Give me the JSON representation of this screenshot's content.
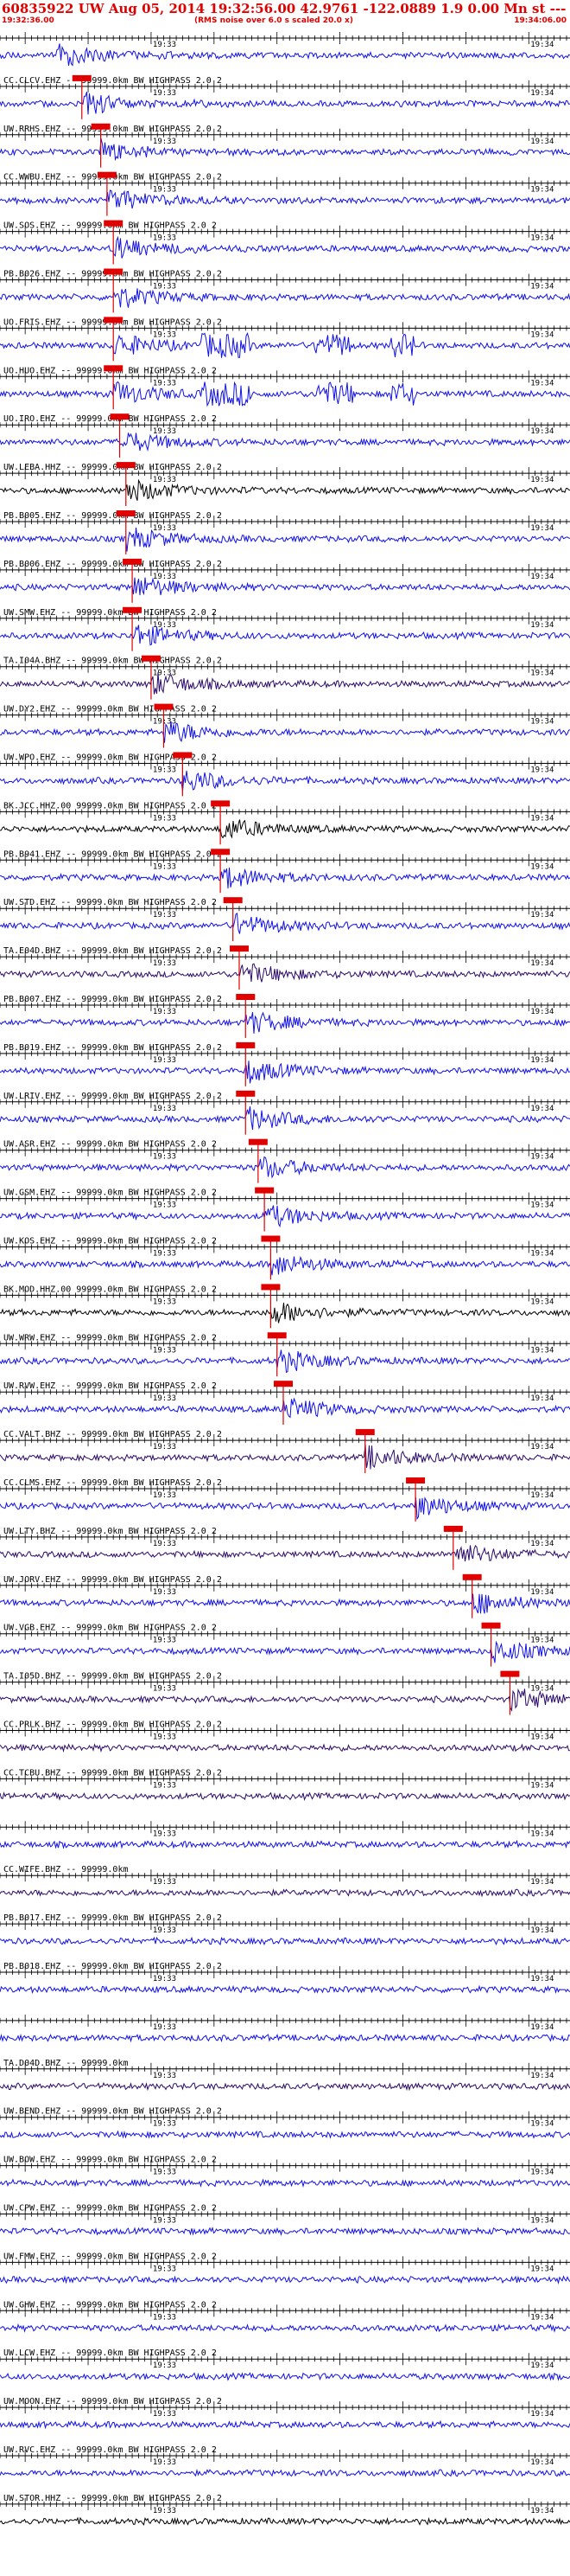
{
  "header": {
    "title": "60835922 UW Aug 05, 2014 19:32:56.00   42.9761 -122.0889  1.9 0.00 Mn st --- -- -- -1",
    "start_time": "19:32:36.00",
    "rms_note": "(RMS noise over 6.0 s scaled 20.0 x)",
    "end_time": "19:34:06.00"
  },
  "tick_labels": {
    "left": "19:33",
    "right": "19:34"
  },
  "colors": {
    "trace_blue": "#1010e8",
    "trace_black": "#000000",
    "trace_purple": "#2a0a6a",
    "pick": "#e00000",
    "axis": "#000000"
  },
  "traces": [
    {
      "label": "",
      "color": "blue",
      "pick": "",
      "pick_sec": 9
    },
    {
      "label": "CC.CLCV.EHZ -- 99999.0km BW  HIGHPASS  2.0  2",
      "color": "blue",
      "pick": "P",
      "pick_sec": 13
    },
    {
      "label": "UW.RRHS.EHZ -- 99999.0km BW  HIGHPASS  2.0  2",
      "color": "blue",
      "pick": "P",
      "pick_sec": 16
    },
    {
      "label": "CC.WWBU.EHZ -- 99999.0km BW  HIGHPASS  2.0  2",
      "color": "blue",
      "pick": "P",
      "pick_sec": 17
    },
    {
      "label": "UW.SOS.EHZ -- 99999.0km BW  HIGHPASS  2.0  2",
      "color": "blue",
      "pick": "P",
      "pick_sec": 18
    },
    {
      "label": "PB.B026.EHZ -- 99999.0km BW  HIGHPASS  2.0  2",
      "color": "blue",
      "pick": "P",
      "pick_sec": 18
    },
    {
      "label": "UO.FRIS.EHZ -- 99999.0km BW  HIGHPASS  2.0  2",
      "color": "blue",
      "pick": "P",
      "pick_sec": 18
    },
    {
      "label": "UO.HUO.EHZ -- 99999.0km BW  HIGHPASS  2.0  2",
      "color": "blue",
      "pick": "P",
      "pick_sec": 18
    },
    {
      "label": "UO.IRO.EHZ -- 99999.0km BW  HIGHPASS  2.0  2",
      "color": "blue",
      "pick": "P",
      "pick_sec": 19
    },
    {
      "label": "UW.LEBA.HHZ -- 99999.0km BW  HIGHPASS  2.0  2",
      "color": "black",
      "pick": "P",
      "pick_sec": 20
    },
    {
      "label": "PB.B005.EHZ -- 99999.0km BW  HIGHPASS  2.0  2",
      "color": "blue",
      "pick": "P",
      "pick_sec": 20
    },
    {
      "label": "PB.B006.EHZ -- 99999.0km BW  HIGHPASS  2.0  2",
      "color": "blue",
      "pick": "P",
      "pick_sec": 21
    },
    {
      "label": "UW.SMW.EHZ -- 99999.0km BW  HIGHPASS  2.0  2",
      "color": "blue",
      "pick": "P",
      "pick_sec": 21
    },
    {
      "label": "TA.I04A.BHZ -- 99999.0km BW  HIGHPASS  2.0  2",
      "color": "purple",
      "pick": "P",
      "pick_sec": 24
    },
    {
      "label": "UW.DY2.EHZ -- 99999.0km BW  HIGHPASS  2.0  2",
      "color": "blue",
      "pick": "P",
      "pick_sec": 26
    },
    {
      "label": "UW.WPO.EHZ -- 99999.0km BW  HIGHPASS  2.0  2",
      "color": "blue",
      "pick": "P",
      "pick_sec": 29
    },
    {
      "label": "BK.JCC.HHZ.00 99999.0km BW  HIGHPASS  2.0  2",
      "color": "black",
      "pick": "P",
      "pick_sec": 35
    },
    {
      "label": "PB.B941.EHZ -- 99999.0km BW  HIGHPASS  2.0  2",
      "color": "blue",
      "pick": "P",
      "pick_sec": 35
    },
    {
      "label": "UW.STD.EHZ -- 99999.0km BW  HIGHPASS  2.0  2",
      "color": "blue",
      "pick": "P",
      "pick_sec": 37
    },
    {
      "label": "TA.E04D.BHZ -- 99999.0km BW  HIGHPASS  2.0  2",
      "color": "purple",
      "pick": "P",
      "pick_sec": 38
    },
    {
      "label": "PB.B007.EHZ -- 99999.0km BW  HIGHPASS  2.0  2",
      "color": "blue",
      "pick": "P",
      "pick_sec": 39
    },
    {
      "label": "PB.B019.EHZ -- 99999.0km BW  HIGHPASS  2.0  2",
      "color": "blue",
      "pick": "P",
      "pick_sec": 39
    },
    {
      "label": "UW.LRIV.EHZ -- 99999.0km BW  HIGHPASS  2.0  2",
      "color": "blue",
      "pick": "P",
      "pick_sec": 39
    },
    {
      "label": "UW.ASR.EHZ -- 99999.0km BW  HIGHPASS  2.0  2",
      "color": "blue",
      "pick": "P",
      "pick_sec": 41
    },
    {
      "label": "UW.GSM.EHZ -- 99999.0km BW  HIGHPASS  2.0  2",
      "color": "blue",
      "pick": "P",
      "pick_sec": 42
    },
    {
      "label": "UW.KOS.EHZ -- 99999.0km BW  HIGHPASS  2.0  2",
      "color": "blue",
      "pick": "P",
      "pick_sec": 43
    },
    {
      "label": "BK.MOD.HHZ.00 99999.0km BW  HIGHPASS  2.0  2",
      "color": "black",
      "pick": "P",
      "pick_sec": 43
    },
    {
      "label": "UW.WRW.EHZ -- 99999.0km BW  HIGHPASS  2.0  2",
      "color": "blue",
      "pick": "P",
      "pick_sec": 44
    },
    {
      "label": "UW.RVW.EHZ -- 99999.0km BW  HIGHPASS  2.0  2",
      "color": "blue",
      "pick": "P",
      "pick_sec": 45
    },
    {
      "label": "CC.VALT.BHZ -- 99999.0km BW  HIGHPASS  2.0  2",
      "color": "purple",
      "pick": "P",
      "pick_sec": 58
    },
    {
      "label": "CC.CLMS.EHZ -- 99999.0km BW  HIGHPASS  2.0  2",
      "color": "blue",
      "pick": "P",
      "pick_sec": 66
    },
    {
      "label": "UW.LTY.BHZ -- 99999.0km BW  HIGHPASS  2.0  2",
      "color": "purple",
      "pick": "P",
      "pick_sec": 72
    },
    {
      "label": "UW.JORV.EHZ -- 99999.0km BW  HIGHPASS  2.0  2",
      "color": "blue",
      "pick": "P",
      "pick_sec": 75
    },
    {
      "label": "UW.VGB.EHZ -- 99999.0km BW  HIGHPASS  2.0  2",
      "color": "blue",
      "pick": "P",
      "pick_sec": 78
    },
    {
      "label": "TA.I05D.BHZ -- 99999.0km BW  HIGHPASS  2.0  2",
      "color": "purple",
      "pick": "P",
      "pick_sec": 81
    },
    {
      "label": "CC.PRLK.BHZ -- 99999.0km BW  HIGHPASS  2.0  2",
      "color": "purple",
      "pick": "",
      "pick_sec": null
    },
    {
      "label": "CC.TCBU.BHZ -- 99999.0km BW  HIGHPASS  2.0  2",
      "color": "purple",
      "pick": "",
      "pick_sec": null
    },
    {
      "label": "",
      "color": "blue",
      "pick": "",
      "pick_sec": null
    },
    {
      "label": "CC.WIFE.BHZ -- 99999.0km",
      "color": "purple",
      "pick": "",
      "pick_sec": null
    },
    {
      "label": "PB.B017.EHZ -- 99999.0km BW  HIGHPASS  2.0  2",
      "color": "blue",
      "pick": "",
      "pick_sec": null
    },
    {
      "label": "PB.B018.EHZ -- 99999.0km BW  HIGHPASS  2.0  2",
      "color": "blue",
      "pick": "",
      "pick_sec": null
    },
    {
      "label": "",
      "color": "blue",
      "pick": "",
      "pick_sec": null
    },
    {
      "label": "TA.D04D.BHZ -- 99999.0km",
      "color": "purple",
      "pick": "",
      "pick_sec": null
    },
    {
      "label": "UW.BEND.EHZ -- 99999.0km BW  HIGHPASS  2.0  2",
      "color": "blue",
      "pick": "",
      "pick_sec": null
    },
    {
      "label": "UW.BOW.EHZ -- 99999.0km BW  HIGHPASS  2.0  2",
      "color": "blue",
      "pick": "",
      "pick_sec": null
    },
    {
      "label": "UW.CPW.EHZ -- 99999.0km BW  HIGHPASS  2.0  2",
      "color": "blue",
      "pick": "",
      "pick_sec": null
    },
    {
      "label": "UW.FMW.EHZ -- 99999.0km BW  HIGHPASS  2.0  2",
      "color": "blue",
      "pick": "",
      "pick_sec": null
    },
    {
      "label": "UW.GHW.EHZ -- 99999.0km BW  HIGHPASS  2.0  2",
      "color": "blue",
      "pick": "",
      "pick_sec": null
    },
    {
      "label": "UW.LCW.EHZ -- 99999.0km BW  HIGHPASS  2.0  2",
      "color": "blue",
      "pick": "",
      "pick_sec": null
    },
    {
      "label": "UW.MOON.EHZ -- 99999.0km BW  HIGHPASS  2.0  2",
      "color": "blue",
      "pick": "",
      "pick_sec": null
    },
    {
      "label": "UW.RVC.EHZ -- 99999.0km BW  HIGHPASS  2.0  2",
      "color": "blue",
      "pick": "",
      "pick_sec": null
    },
    {
      "label": "UW.STOR.HHZ -- 99999.0km BW  HIGHPASS  2.0  2",
      "color": "black",
      "pick": "",
      "pick_sec": null
    }
  ]
}
